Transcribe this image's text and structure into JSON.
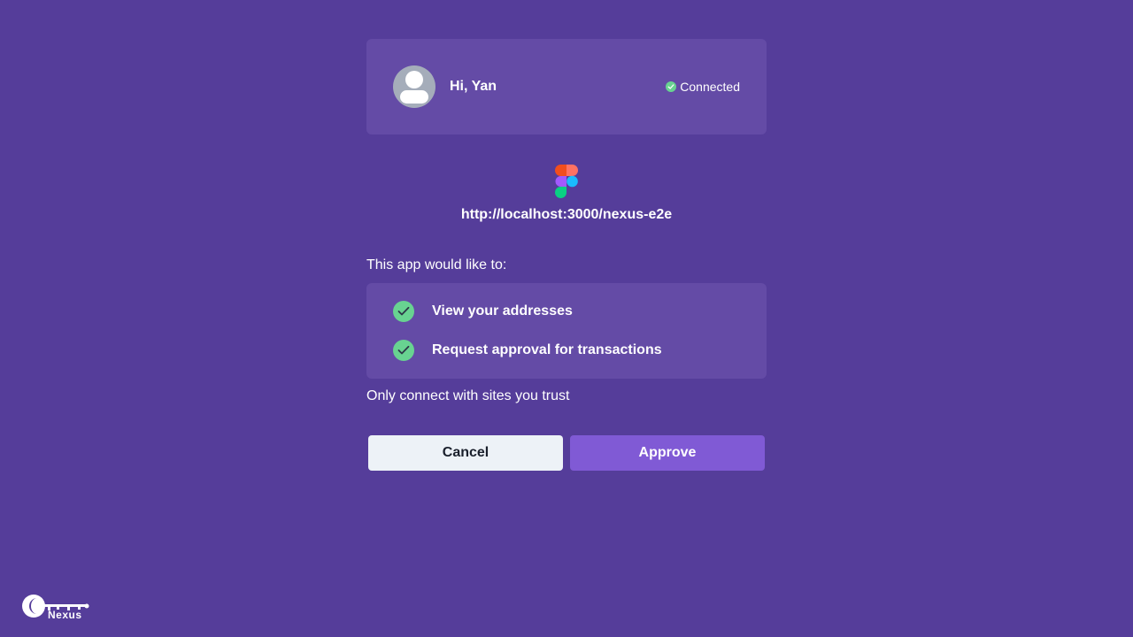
{
  "account": {
    "greeting": "Hi, Yan",
    "status": "Connected",
    "status_color": "#68d391"
  },
  "site": {
    "url": "http://localhost:3000/nexus-e2e",
    "logo_icon": "figma-logo-icon"
  },
  "permissions": {
    "intro": "This app would like to:",
    "items": [
      {
        "label": "View your addresses"
      },
      {
        "label": "Request approval for transactions"
      }
    ]
  },
  "trust_note": "Only connect with sites you trust",
  "actions": {
    "cancel_label": "Cancel",
    "approve_label": "Approve"
  },
  "brand": {
    "name": "Nexus"
  },
  "colors": {
    "background": "#553d9a",
    "card": "#644ba6",
    "approve": "#805ad5",
    "cancel": "#edf2f7",
    "check": "#68d391"
  }
}
